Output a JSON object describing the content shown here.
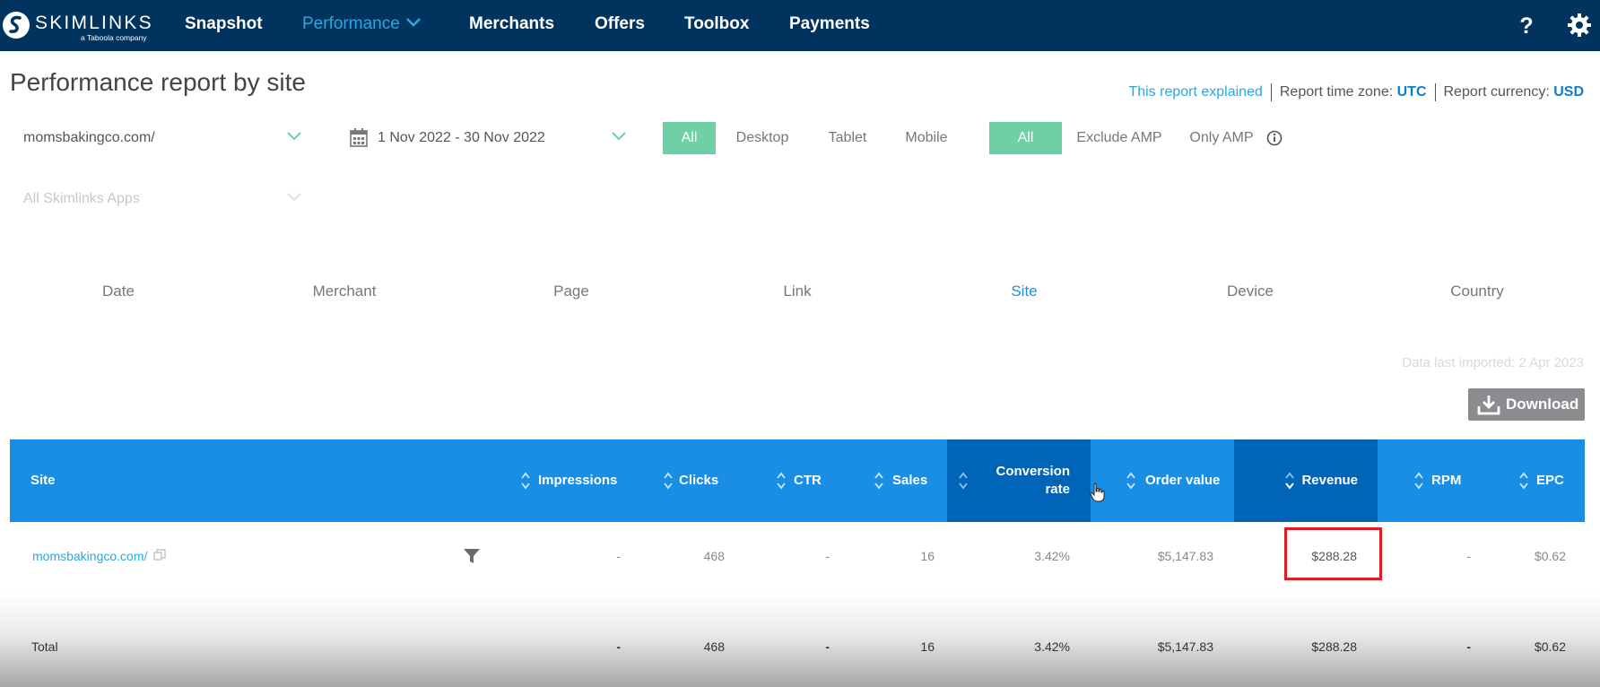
{
  "app": {
    "brand_name": "SKIMLINKS",
    "brand_sub": "a Taboola company"
  },
  "nav": {
    "items": [
      {
        "label": "Snapshot"
      },
      {
        "label": "Performance"
      },
      {
        "label": "Merchants"
      },
      {
        "label": "Offers"
      },
      {
        "label": "Toolbox"
      },
      {
        "label": "Payments"
      }
    ],
    "active": "Performance",
    "help_icon": "question-icon",
    "settings_icon": "gear-icon"
  },
  "header": {
    "title": "Performance report by site",
    "report_explained": "This report explained",
    "timezone_label": "Report time zone:",
    "timezone_value": "UTC",
    "currency_label": "Report currency:",
    "currency_value": "USD"
  },
  "filters": {
    "site": "momsbakingco.com/",
    "date_range": "1 Nov 2022 - 30 Nov 2022",
    "apps_placeholder": "All Skimlinks Apps",
    "device_options": [
      "All",
      "Desktop",
      "Tablet",
      "Mobile"
    ],
    "device_selected": "All",
    "amp_options": [
      "All",
      "Exclude AMP",
      "Only AMP"
    ],
    "amp_selected": "All",
    "amp_info_icon": "info-icon"
  },
  "dimension_tabs": {
    "items": [
      "Date",
      "Merchant",
      "Page",
      "Link",
      "Site",
      "Device",
      "Country"
    ],
    "active": "Site"
  },
  "data_status": {
    "last_imported": "Data last imported: 2 Apr 2023",
    "download_label": "Download"
  },
  "table": {
    "columns": [
      "Site",
      "Impressions",
      "Clicks",
      "CTR",
      "Sales",
      "Conversion rate",
      "Order value",
      "Revenue",
      "RPM",
      "EPC"
    ],
    "conversion_line1": "Conversion",
    "conversion_line2": "rate",
    "rows": [
      {
        "site": "momsbakingco.com/",
        "impressions": "-",
        "clicks": "468",
        "ctr": "-",
        "sales": "16",
        "conversion": "3.42%",
        "order_value": "$5,147.83",
        "revenue": "$288.28",
        "rpm": "-",
        "epc": "$0.62"
      }
    ],
    "total": {
      "label": "Total",
      "impressions": "-",
      "clicks": "468",
      "ctr": "-",
      "sales": "16",
      "conversion": "3.42%",
      "order_value": "$5,147.83",
      "revenue": "$288.28",
      "rpm": "-",
      "epc": "$0.62"
    }
  },
  "colors": {
    "nav_bg": "#00335e",
    "accent": "#29a8e0",
    "table_header": "#1a8de4",
    "table_header_sorted": "#0065b6",
    "toggle_on": "#6fd0a5",
    "highlight": "#e01b22"
  }
}
